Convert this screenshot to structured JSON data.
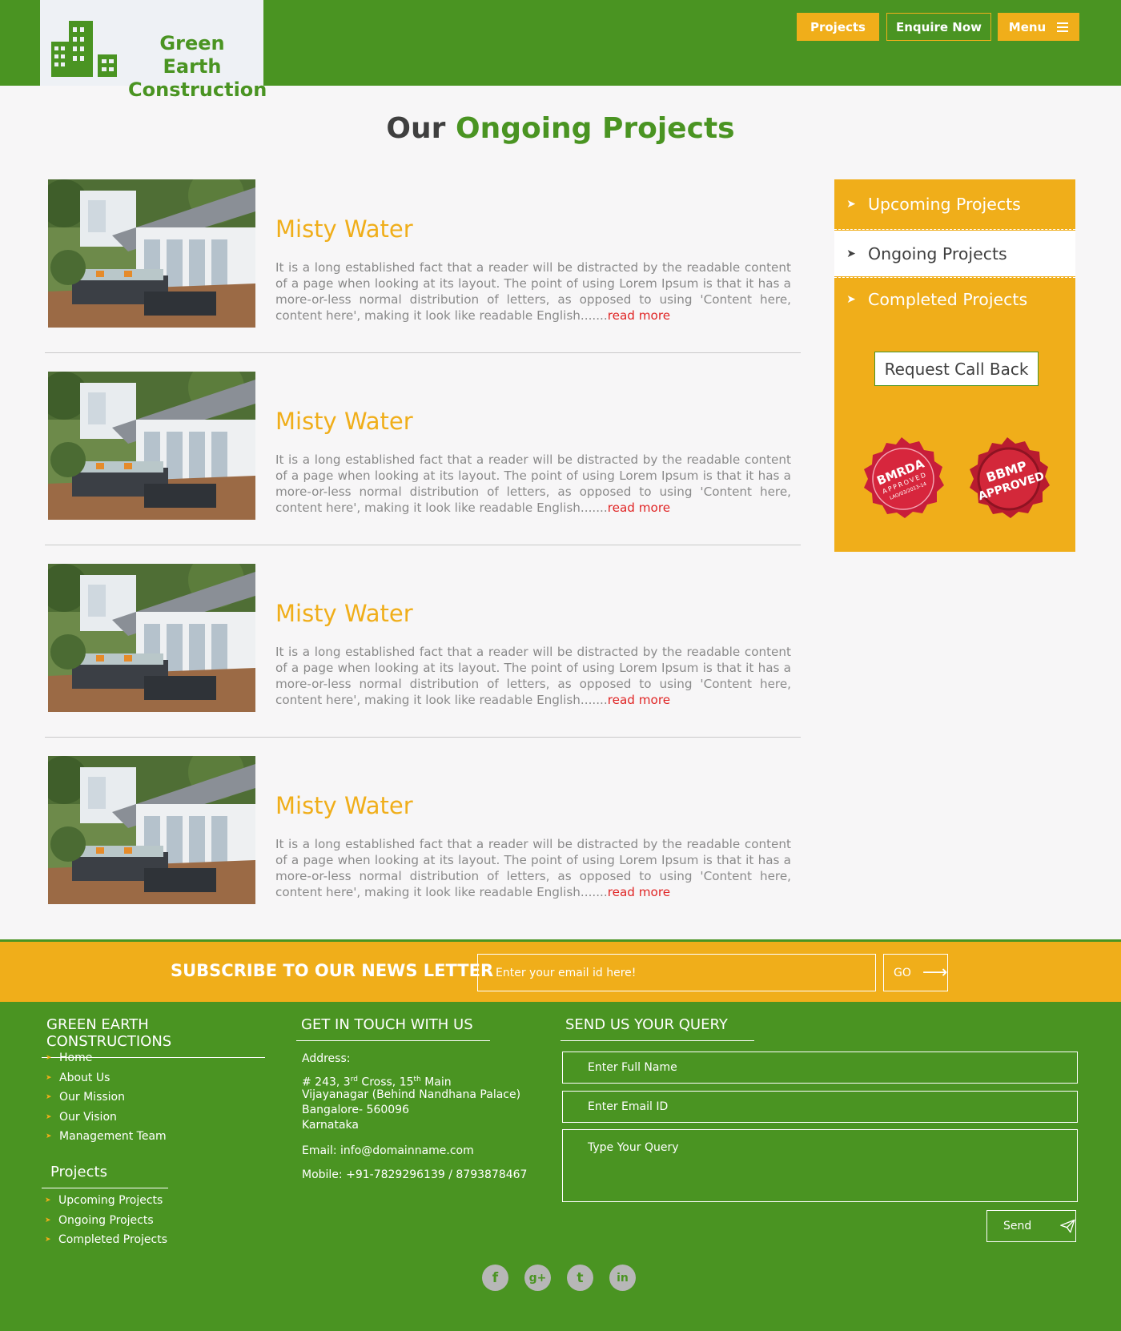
{
  "header": {
    "logo_line1": "Green Earth",
    "logo_line2": "Construction",
    "nav": {
      "projects": "Projects",
      "enquire": "Enquire Now",
      "menu": "Menu"
    }
  },
  "page_title": {
    "part1": "Our",
    "part2": "Ongoing Projects"
  },
  "projects": [
    {
      "title": "Misty Water",
      "desc": "It is a long established fact that a reader will be distracted by the readable content of a page when looking at its layout. The point of using Lorem Ipsum is that it has a more-or-less normal distribution of letters, as opposed to using 'Content here, content here', making it look like readable English.......",
      "more": "read more"
    },
    {
      "title": "Misty Water",
      "desc": "It is a long established fact that a reader will be distracted by the readable content of a page when looking at its layout. The point of using Lorem Ipsum is that it has a more-or-less normal distribution of letters, as opposed to using 'Content here, content here', making it look like readable English.......",
      "more": "read more"
    },
    {
      "title": "Misty Water",
      "desc": "It is a long established fact that a reader will be distracted by the readable content of a page when looking at its layout. The point of using Lorem Ipsum is that it has a more-or-less normal distribution of letters, as opposed to using 'Content here, content here', making it look like readable English.......",
      "more": "read more"
    },
    {
      "title": "Misty Water",
      "desc": "It is a long established fact that a reader will be distracted by the readable content of a page when looking at its layout. The point of using Lorem Ipsum is that it has a more-or-less normal distribution of letters, as opposed to using 'Content here, content here', making it look like readable English.......",
      "more": "read more"
    }
  ],
  "sidebar": {
    "items": [
      "Upcoming Projects",
      "Ongoing Projects",
      "Completed Projects"
    ],
    "active": "Ongoing Projects",
    "callback": "Request Call Back",
    "seals": {
      "bmrda": {
        "line1": "BMRDA",
        "line2": "APPROVED",
        "line3": "LAO/03/2013-14"
      },
      "bbmp": {
        "line1": "BBMP",
        "line2": "APPROVED"
      }
    }
  },
  "newsletter": {
    "title": "SUBSCRIBE TO OUR NEWS LETTER",
    "placeholder": "Enter your email id here!",
    "button": "GO"
  },
  "footer": {
    "col1": {
      "heading": "GREEN EARTH CONSTRUCTIONS",
      "links": [
        "Home",
        "About Us",
        "Our Mission",
        "Our Vision",
        "Management Team"
      ],
      "projects_heading": "Projects",
      "project_links": [
        "Upcoming Projects",
        "Ongoing Projects",
        "Completed Projects"
      ]
    },
    "col2": {
      "heading": "GET IN TOUCH WITH US",
      "address_label": "Address:",
      "address_line1_a": "# 243, 3",
      "address_line1_sup1": "rd",
      "address_line1_b": " Cross, 15",
      "address_line1_sup2": "th",
      "address_line1_c": " Main",
      "address_line2": "Vijayanagar (Behind Nandhana Palace)",
      "address_line3": "Bangalore- 560096",
      "address_line4": "Karnataka",
      "email": "Email: info@domainname.com",
      "mobile": "Mobile: +91-7829296139 / 8793878467"
    },
    "col3": {
      "heading": "SEND US YOUR QUERY",
      "name_placeholder": "Enter Full Name",
      "email_placeholder": "Enter Email ID",
      "query_placeholder": "Type Your Query",
      "send": "Send"
    },
    "social": {
      "facebook": "f",
      "google_plus": "g+",
      "twitter": "t",
      "linkedin": "in"
    }
  },
  "colors": {
    "green": "#4a9422",
    "orange": "#f0ae1a",
    "read_more": "#e02525",
    "seal_red": "#d7263d"
  }
}
